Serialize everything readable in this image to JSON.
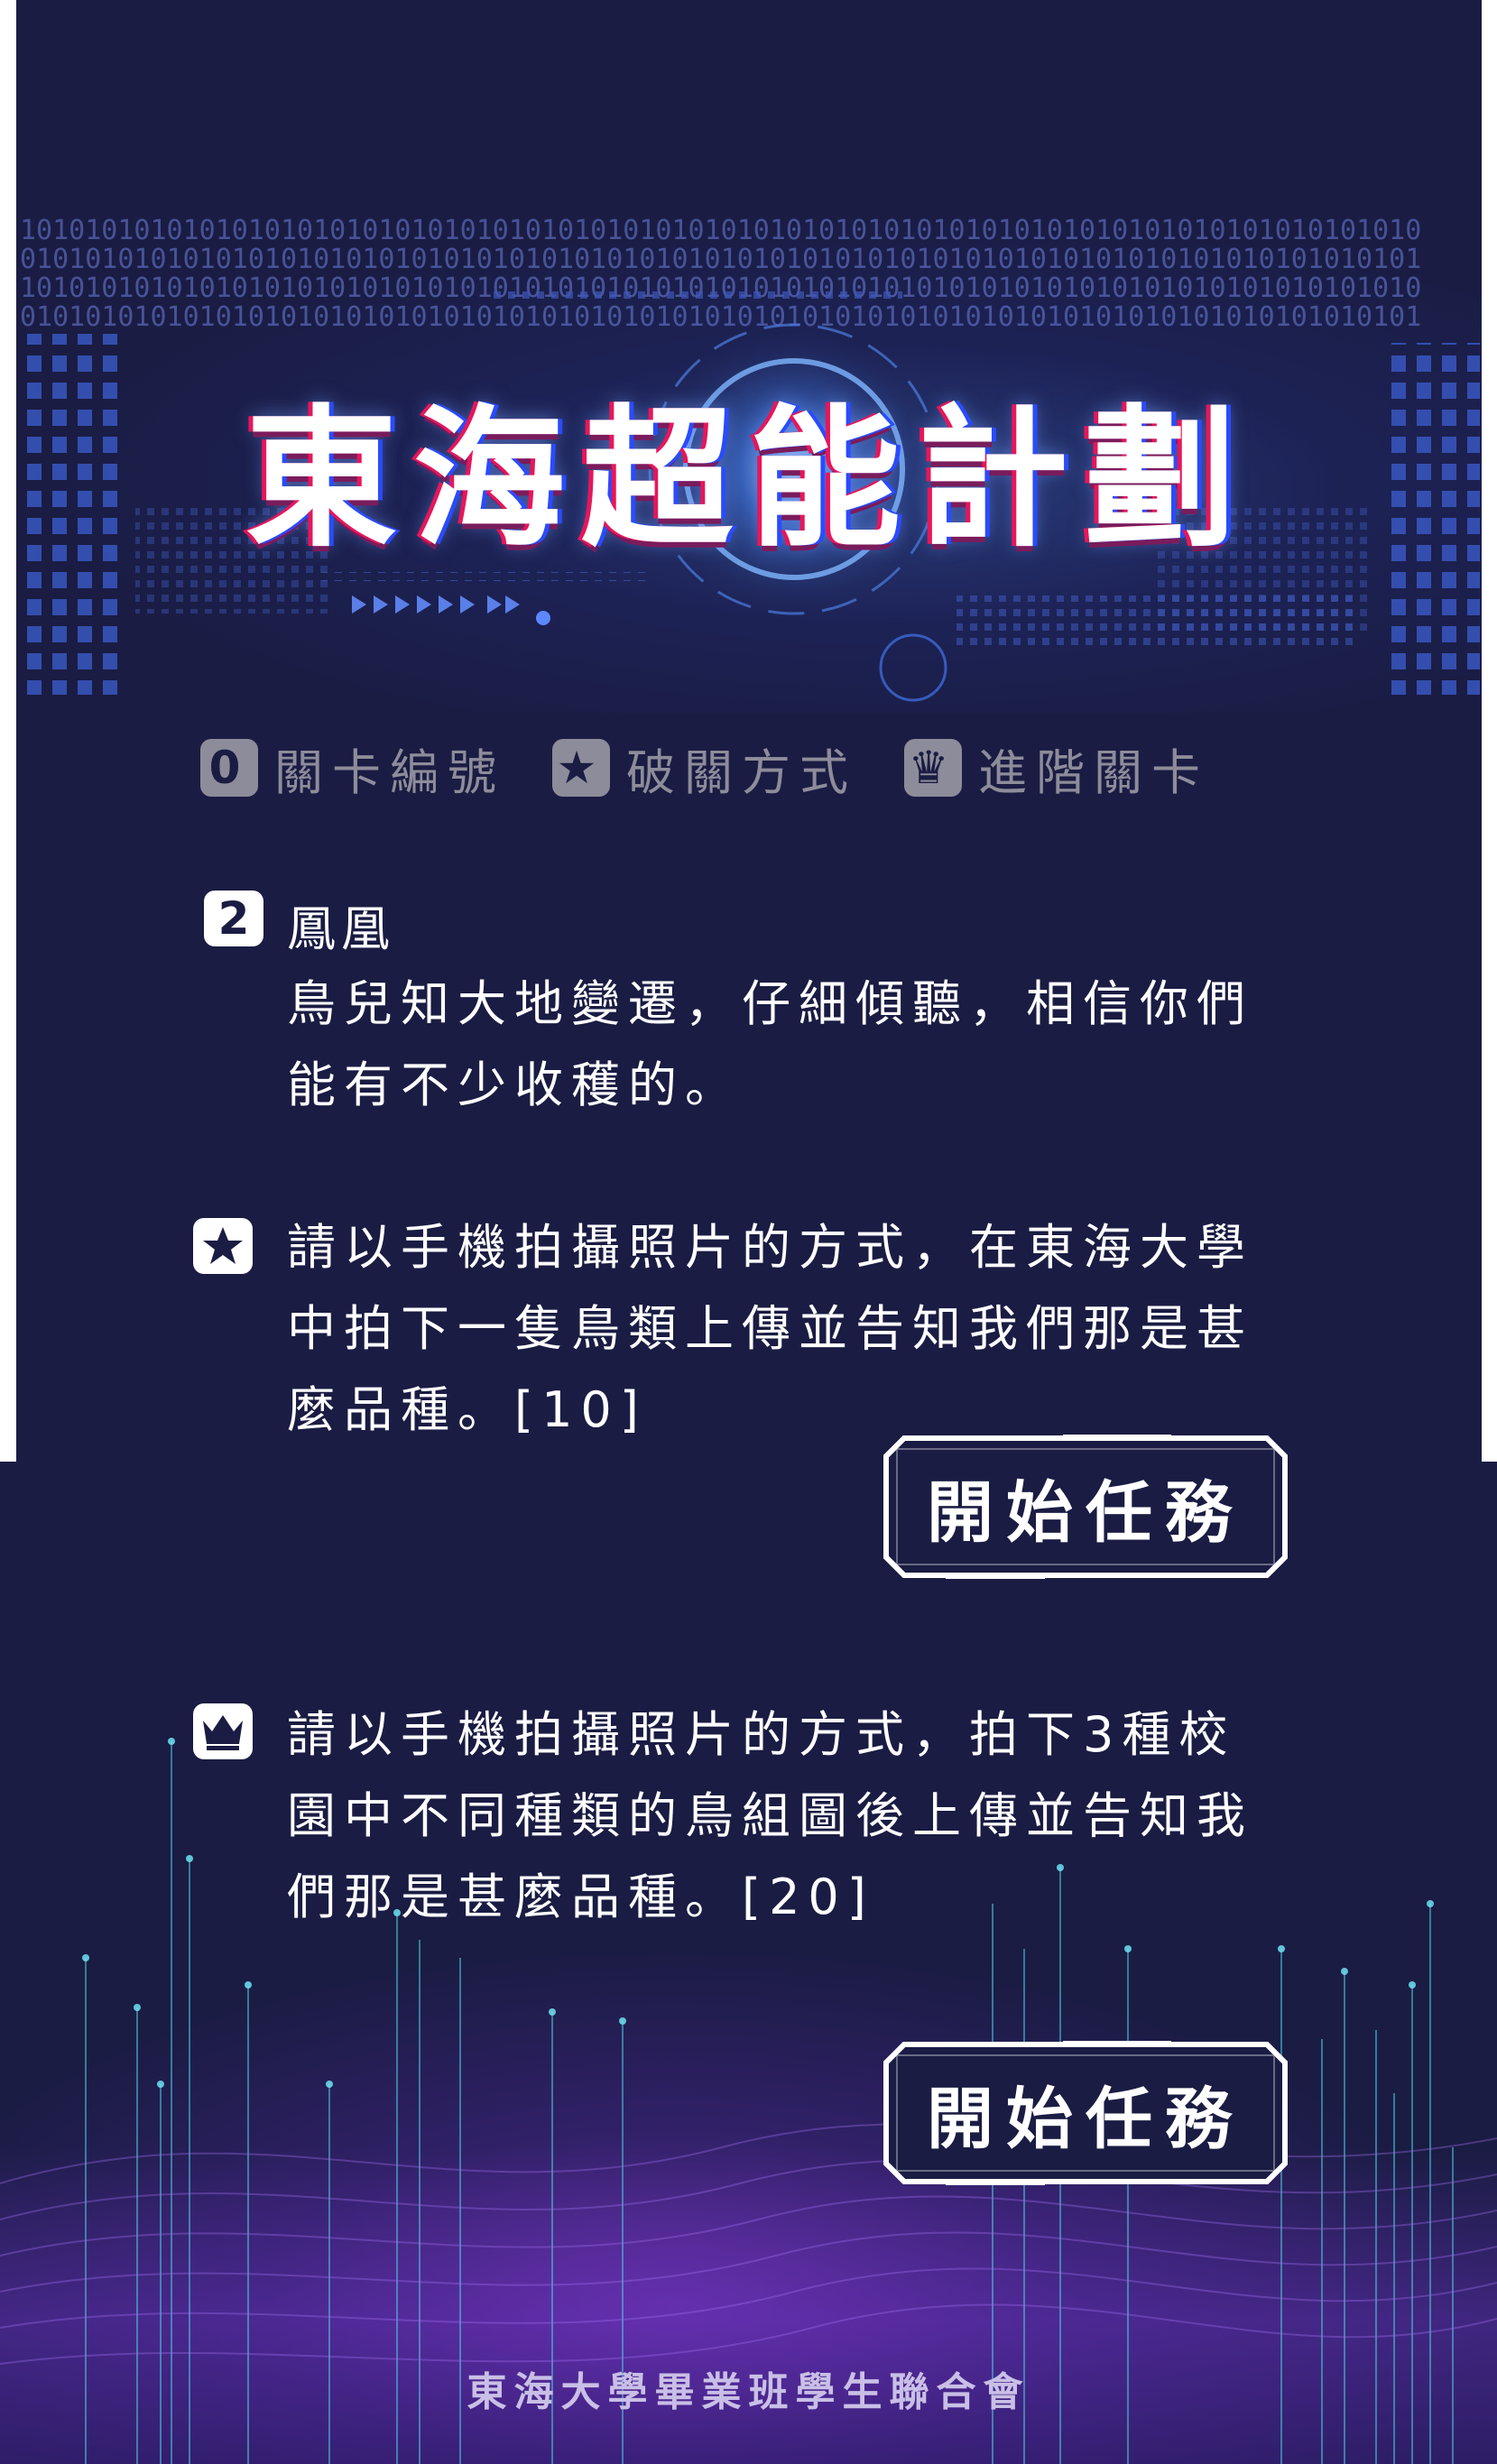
{
  "title": "東海超能計劃",
  "legend": [
    {
      "symbol": "0",
      "label": "關卡編號",
      "icon": "number-badge-icon"
    },
    {
      "symbol": "★",
      "label": "破關方式",
      "icon": "star-icon"
    },
    {
      "symbol": "♛",
      "label": "進階關卡",
      "icon": "crown-icon"
    }
  ],
  "stage": {
    "number": "2",
    "name": "鳳凰",
    "description_line1": "鳥兒知大地變遷，仔細傾聽，相信你們",
    "description_line2": "能有不少收穫的。"
  },
  "task_basic": {
    "icon": "star-icon",
    "line1": "請以手機拍攝照片的方式，在東海大學",
    "line2": "中拍下一隻鳥類上傳並告知我們那是甚",
    "line3": "麼品種。[10]",
    "button_label": "開始任務"
  },
  "task_advanced": {
    "icon": "crown-icon",
    "line1": "請以手機拍攝照片的方式，拍下3種校",
    "line2": "園中不同種類的鳥組圖後上傳並告知我",
    "line3": "們那是甚麼品種。[20]",
    "button_label": "開始任務"
  },
  "footer": "東海大學畢業班學生聯合會",
  "colors": {
    "background": "#1a1c43",
    "legend_gray": "#8d8c9a",
    "accent_pink": "#e8155a",
    "accent_blue": "#2a4bff",
    "glow_purple": "#9a3ce6"
  }
}
